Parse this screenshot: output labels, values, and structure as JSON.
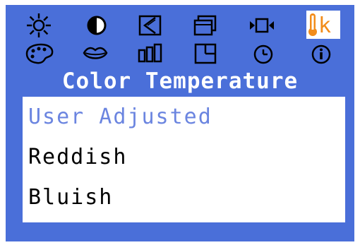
{
  "osd": {
    "title": "Color Temperature",
    "icons_row1": [
      "brightness-icon",
      "contrast-icon",
      "image-adjust-icon",
      "size-position-icon",
      "input-source-icon",
      "color-temperature-icon"
    ],
    "icons_row2": [
      "color-palette-icon",
      "lips-skin-tone-icon",
      "image-mode-icon",
      "window-layout-icon",
      "clock-icon",
      "information-icon"
    ],
    "selected_icon": "color-temperature-icon",
    "selected_icon_text": "k",
    "options": [
      {
        "label": "User Adjusted",
        "active": true
      },
      {
        "label": "Reddish",
        "active": false
      },
      {
        "label": "Bluish",
        "active": false
      }
    ]
  },
  "colors": {
    "background": "#4a6fd9",
    "panel": "#ffffff",
    "highlight_text": "#6b85e0",
    "selected_icon_accent": "#f28c1a"
  }
}
